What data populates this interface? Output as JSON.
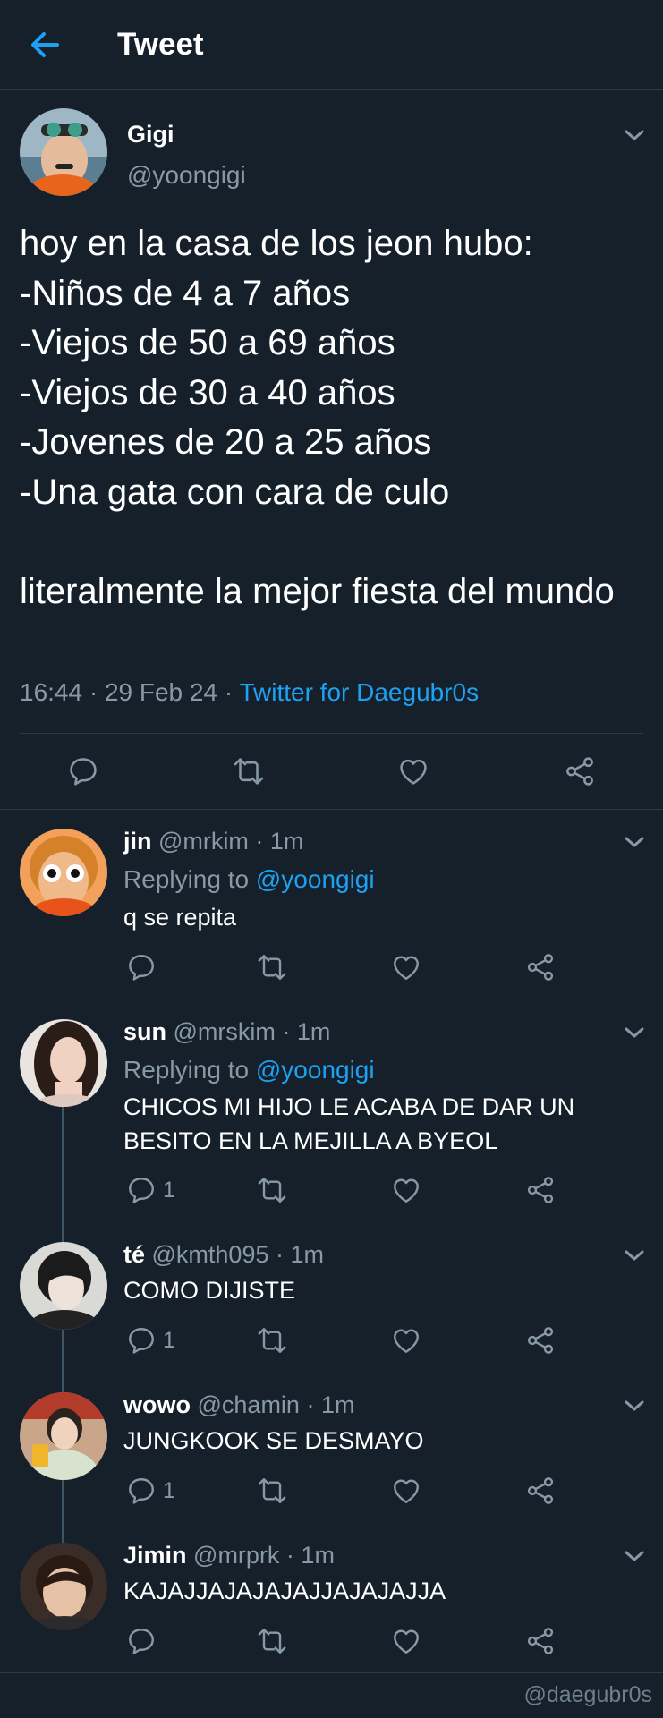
{
  "header": {
    "title": "Tweet"
  },
  "main_tweet": {
    "name": "Gigi",
    "handle": "@yoongigi",
    "text": "hoy en la casa de los jeon hubo:\n-Niños de 4 a 7 años\n-Viejos de 50 a 69 años\n-Viejos de 30 a 40 años\n-Jovenes de 20 a 25 años\n-Una gata con cara de culo\n\nliteralmente la mejor fiesta del mundo",
    "time": "16:44 · 29 Feb 24 · ",
    "source": "Twitter for Daegubr0s"
  },
  "replies": [
    {
      "name": "jin",
      "meta": " @mrkim · 1m",
      "replying_prefix": "Replying to ",
      "replying_handle": "@yoongigi",
      "text": "q se repita",
      "reply_count": ""
    },
    {
      "name": "sun",
      "meta": " @mrskim · 1m",
      "replying_prefix": "Replying to ",
      "replying_handle": "@yoongigi",
      "text": "CHICOS MI HIJO LE ACABA DE DAR UN BESITO EN LA MEJILLA A BYEOL",
      "reply_count": "1"
    },
    {
      "name": "té",
      "meta": " @kmth095 · 1m",
      "text": "COMO DIJISTE",
      "reply_count": "1"
    },
    {
      "name": "wowo",
      "meta": " @chamin · 1m",
      "text": "JUNGKOOK SE DESMAYO",
      "reply_count": "1"
    },
    {
      "name": "Jimin",
      "meta": " @mrprk · 1m",
      "text": "KAJAJJAJAJAJAJJAJAJAJJA",
      "reply_count": ""
    }
  ],
  "watermark": "@daegubr0s",
  "colors": {
    "background": "#15202b",
    "accent": "#1da1f2",
    "secondary_text": "#8899a6",
    "divider": "#2b3a47"
  }
}
